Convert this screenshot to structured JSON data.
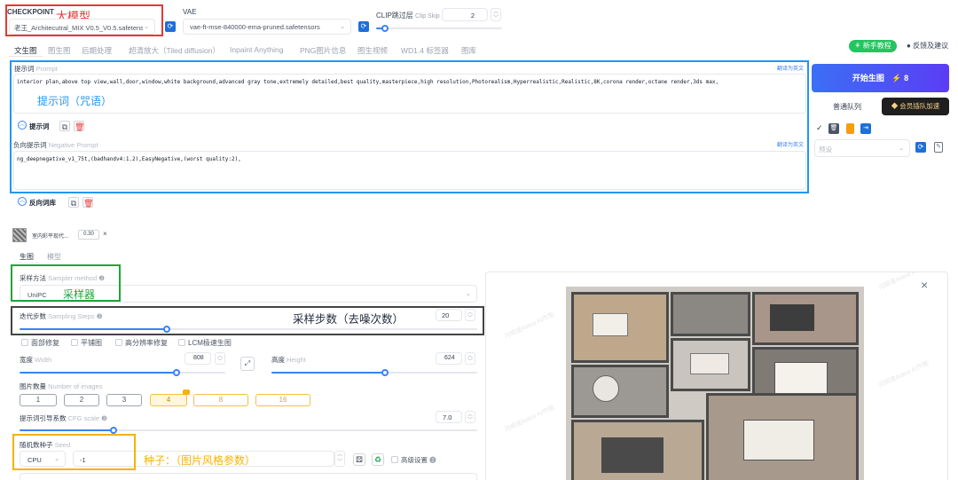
{
  "checkpoint": {
    "label": "CHECKPOINT",
    "value": "老王_Architecutral_MIX V0.5_V0.5.safetensors",
    "annotation": "大模型"
  },
  "vae": {
    "label": "VAE",
    "value": "vae-ft-mse-840000-ema-pruned.safetensors"
  },
  "clip": {
    "label": "CLIP跳过层",
    "sublabel": "Clip Skip",
    "value": "2",
    "fill_fraction": 0.05
  },
  "tabs": [
    {
      "label": "文生图",
      "active": true
    },
    {
      "label": "图生图",
      "active": false
    },
    {
      "label": "后期处理",
      "active": false
    },
    {
      "label": "超清放大（Tiled diffusion）",
      "active": false
    },
    {
      "label": "Inpaint Anything",
      "active": false
    },
    {
      "label": "PNG图片信息",
      "active": false
    },
    {
      "label": "图生视频",
      "active": false
    },
    {
      "label": "WD1.4 标签器",
      "active": false
    },
    {
      "label": "图库",
      "active": false
    }
  ],
  "top_right": {
    "tutorial": "新手教程",
    "feedback": "反馈及建议"
  },
  "prompt": {
    "label": "提示词",
    "placeholder_label": "Prompt",
    "translate": "翻译为英文",
    "text": "interior plan,above top view,wall,door,window,white background,advanced gray tone,extremely detailed,best quality,masterpiece,high resolution,Photorealism,Hyperrealistic,Realistic,8K,corona render,octane render,3ds max,",
    "annotation": "提示词（咒语）",
    "toolbar_label": "提示词"
  },
  "negative": {
    "label": "负向提示词",
    "placeholder_label": "Negative Prompt",
    "translate": "翻译为英文",
    "text": "ng_deepnegative_v1_75t,(badhandv4:1.2),EasyNegative,(worst quality:2),",
    "toolbar_label": "反向词库"
  },
  "generate": {
    "label": "开始生图",
    "cost": "8",
    "queue_normal": "普通队列",
    "queue_member": "会员插队加速"
  },
  "style_select": {
    "placeholder": "预设"
  },
  "lora": {
    "name": "室内彩平现代...",
    "weight": "0.30",
    "close": "×"
  },
  "subtabs": [
    {
      "label": "生图",
      "active": true
    },
    {
      "label": "模型",
      "active": false
    }
  ],
  "sampler": {
    "label": "采样方法",
    "sublabel": "Sampler method",
    "value": "UniPC",
    "annotation": "采样器"
  },
  "steps": {
    "label": "迭代步数",
    "sublabel": "Sampling Steps",
    "value": "20",
    "fill_fraction": 0.2,
    "annotation": "采样步数（去噪次数）"
  },
  "options": [
    {
      "label": "面部修复",
      "checked": false
    },
    {
      "label": "平铺图",
      "checked": false
    },
    {
      "label": "高分辨率修复",
      "checked": false
    },
    {
      "label": "LCM极速生图",
      "checked": false
    }
  ],
  "width": {
    "label": "宽度",
    "sublabel": "Width",
    "value": "808",
    "fill_fraction": 0.4
  },
  "height": {
    "label": "高度",
    "sublabel": "Height",
    "value": "624",
    "fill_fraction": 0.3
  },
  "batch": {
    "label": "图片数量",
    "sublabel": "Number of images",
    "options": [
      "1",
      "2",
      "3",
      "4",
      "8",
      "16"
    ],
    "selected": "4"
  },
  "cfg": {
    "label": "提示词引导系数",
    "sublabel": "CFG scale",
    "value": "7.0",
    "fill_fraction": 0.2
  },
  "seed": {
    "label": "随机数种子",
    "sublabel": "Seed",
    "device": "CPU",
    "value": "-1",
    "advanced": "高级设置",
    "annotation": "种子：（图片风格参数）"
  },
  "preview": {
    "close": "×",
    "watermark": "河姆渡Aidea AI作图"
  },
  "colors": {
    "accent": "#1e6fd9",
    "generate_gradient_start": "#3b6ff5",
    "generate_gradient_end": "#5b3df5",
    "annot_red": "#e53935",
    "annot_blue": "#2196f3",
    "annot_green": "#22a33a",
    "annot_dark": "#444444",
    "annot_orange": "#f5b300"
  }
}
